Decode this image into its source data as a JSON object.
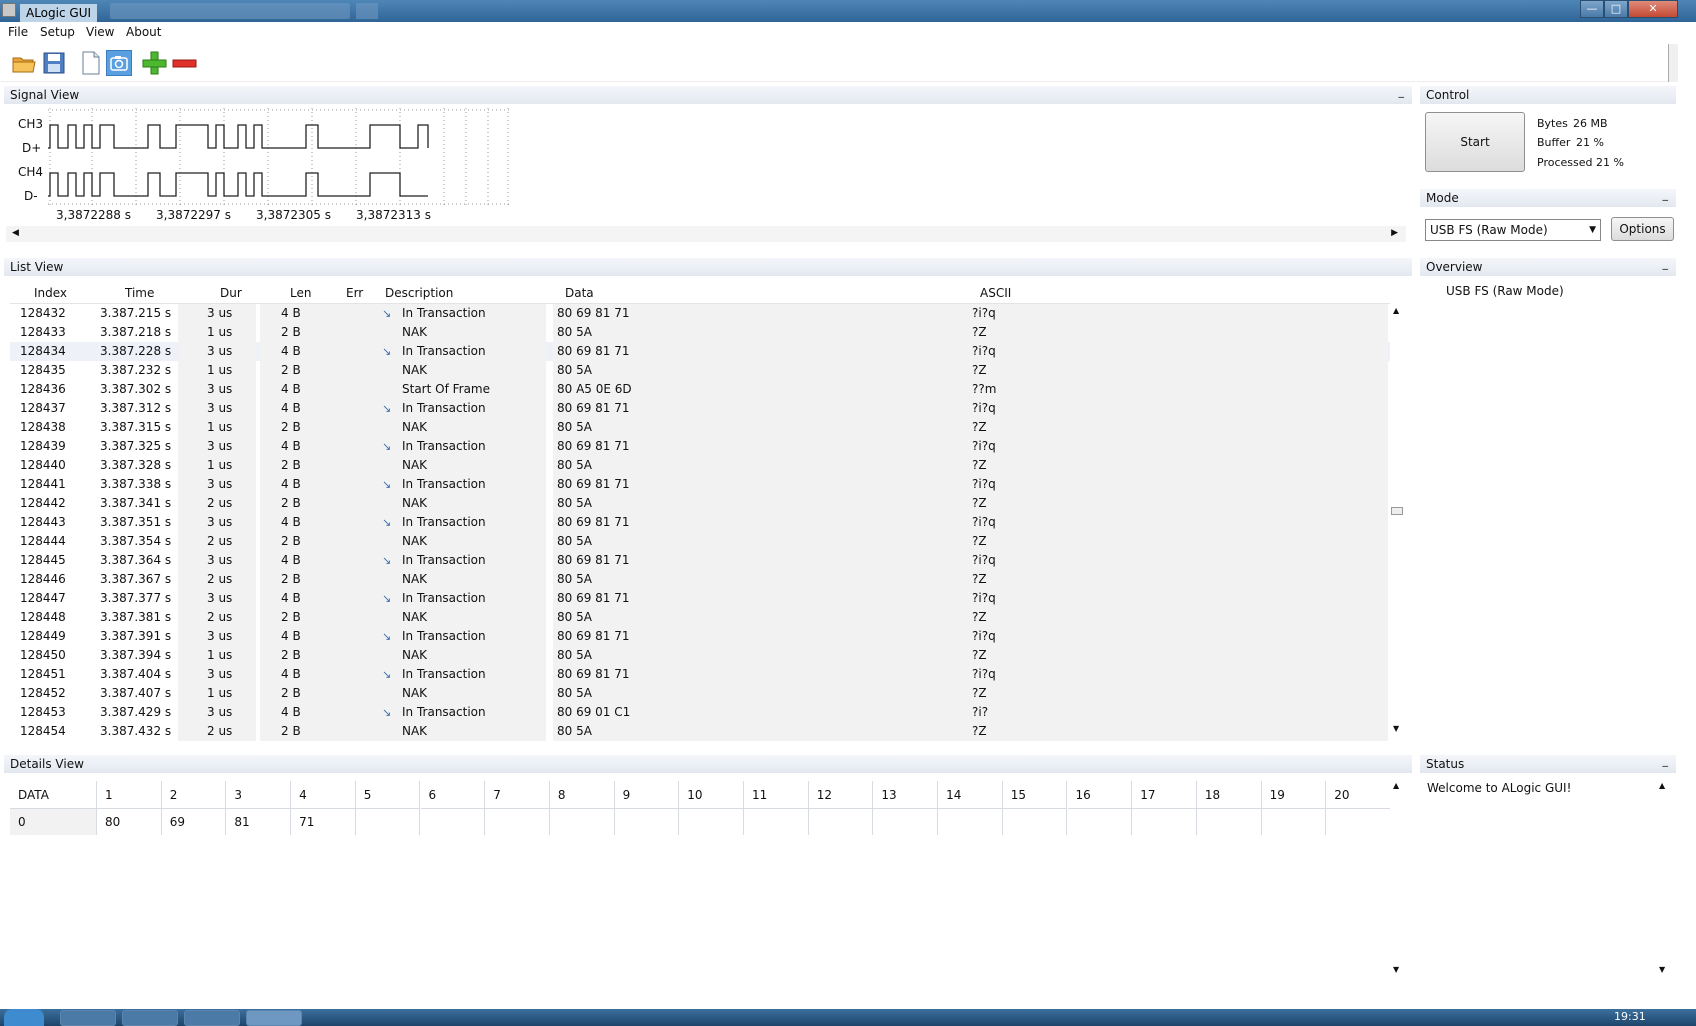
{
  "window": {
    "title": "ALogic GUI"
  },
  "menu": [
    "File",
    "Setup",
    "View",
    "About"
  ],
  "panels": {
    "signal_view": "Signal View",
    "list_view": "List View",
    "details_view": "Details View",
    "control": "Control",
    "mode": "Mode",
    "overview": "Overview",
    "status": "Status",
    "minimize": "_"
  },
  "signal": {
    "channels": [
      "CH3",
      "D+",
      "CH4",
      "D-"
    ],
    "time_labels": [
      "3,3872288 s",
      "3,3872297 s",
      "3,3872305 s",
      "3,3872313 s"
    ]
  },
  "list": {
    "columns": [
      "Index",
      "Time",
      "Dur",
      "Len",
      "Err",
      "Description",
      "Data",
      "ASCII"
    ],
    "rows": [
      {
        "index": "128432",
        "time": "3.387.215 s",
        "dur": "3 us",
        "len": "4 B",
        "err": "",
        "desc": "In Transaction",
        "data": "80 69 81 71",
        "ascii": "?i?q",
        "icon": true
      },
      {
        "index": "128433",
        "time": "3.387.218 s",
        "dur": "1 us",
        "len": "2 B",
        "err": "",
        "desc": "NAK",
        "data": "80 5A",
        "ascii": "?Z",
        "icon": false
      },
      {
        "index": "128434",
        "time": "3.387.228 s",
        "dur": "3 us",
        "len": "4 B",
        "err": "",
        "desc": "In Transaction",
        "data": "80 69 81 71",
        "ascii": "?i?q",
        "icon": true
      },
      {
        "index": "128435",
        "time": "3.387.232 s",
        "dur": "1 us",
        "len": "2 B",
        "err": "",
        "desc": "NAK",
        "data": "80 5A",
        "ascii": "?Z",
        "icon": false
      },
      {
        "index": "128436",
        "time": "3.387.302 s",
        "dur": "3 us",
        "len": "4 B",
        "err": "",
        "desc": "Start Of Frame",
        "data": "80 A5 0E 6D",
        "ascii": "??m",
        "icon": false
      },
      {
        "index": "128437",
        "time": "3.387.312 s",
        "dur": "3 us",
        "len": "4 B",
        "err": "",
        "desc": "In Transaction",
        "data": "80 69 81 71",
        "ascii": "?i?q",
        "icon": true
      },
      {
        "index": "128438",
        "time": "3.387.315 s",
        "dur": "1 us",
        "len": "2 B",
        "err": "",
        "desc": "NAK",
        "data": "80 5A",
        "ascii": "?Z",
        "icon": false
      },
      {
        "index": "128439",
        "time": "3.387.325 s",
        "dur": "3 us",
        "len": "4 B",
        "err": "",
        "desc": "In Transaction",
        "data": "80 69 81 71",
        "ascii": "?i?q",
        "icon": true
      },
      {
        "index": "128440",
        "time": "3.387.328 s",
        "dur": "1 us",
        "len": "2 B",
        "err": "",
        "desc": "NAK",
        "data": "80 5A",
        "ascii": "?Z",
        "icon": false
      },
      {
        "index": "128441",
        "time": "3.387.338 s",
        "dur": "3 us",
        "len": "4 B",
        "err": "",
        "desc": "In Transaction",
        "data": "80 69 81 71",
        "ascii": "?i?q",
        "icon": true
      },
      {
        "index": "128442",
        "time": "3.387.341 s",
        "dur": "2 us",
        "len": "2 B",
        "err": "",
        "desc": "NAK",
        "data": "80 5A",
        "ascii": "?Z",
        "icon": false
      },
      {
        "index": "128443",
        "time": "3.387.351 s",
        "dur": "3 us",
        "len": "4 B",
        "err": "",
        "desc": "In Transaction",
        "data": "80 69 81 71",
        "ascii": "?i?q",
        "icon": true
      },
      {
        "index": "128444",
        "time": "3.387.354 s",
        "dur": "2 us",
        "len": "2 B",
        "err": "",
        "desc": "NAK",
        "data": "80 5A",
        "ascii": "?Z",
        "icon": false
      },
      {
        "index": "128445",
        "time": "3.387.364 s",
        "dur": "3 us",
        "len": "4 B",
        "err": "",
        "desc": "In Transaction",
        "data": "80 69 81 71",
        "ascii": "?i?q",
        "icon": true
      },
      {
        "index": "128446",
        "time": "3.387.367 s",
        "dur": "2 us",
        "len": "2 B",
        "err": "",
        "desc": "NAK",
        "data": "80 5A",
        "ascii": "?Z",
        "icon": false
      },
      {
        "index": "128447",
        "time": "3.387.377 s",
        "dur": "3 us",
        "len": "4 B",
        "err": "",
        "desc": "In Transaction",
        "data": "80 69 81 71",
        "ascii": "?i?q",
        "icon": true
      },
      {
        "index": "128448",
        "time": "3.387.381 s",
        "dur": "2 us",
        "len": "2 B",
        "err": "",
        "desc": "NAK",
        "data": "80 5A",
        "ascii": "?Z",
        "icon": false
      },
      {
        "index": "128449",
        "time": "3.387.391 s",
        "dur": "3 us",
        "len": "4 B",
        "err": "",
        "desc": "In Transaction",
        "data": "80 69 81 71",
        "ascii": "?i?q",
        "icon": true
      },
      {
        "index": "128450",
        "time": "3.387.394 s",
        "dur": "1 us",
        "len": "2 B",
        "err": "",
        "desc": "NAK",
        "data": "80 5A",
        "ascii": "?Z",
        "icon": false
      },
      {
        "index": "128451",
        "time": "3.387.404 s",
        "dur": "3 us",
        "len": "4 B",
        "err": "",
        "desc": "In Transaction",
        "data": "80 69 81 71",
        "ascii": "?i?q",
        "icon": true
      },
      {
        "index": "128452",
        "time": "3.387.407 s",
        "dur": "1 us",
        "len": "2 B",
        "err": "",
        "desc": "NAK",
        "data": "80 5A",
        "ascii": "?Z",
        "icon": false
      },
      {
        "index": "128453",
        "time": "3.387.429 s",
        "dur": "3 us",
        "len": "4 B",
        "err": "",
        "desc": "In Transaction",
        "data": "80 69 01 C1",
        "ascii": "?i?",
        "icon": true
      },
      {
        "index": "128454",
        "time": "3.387.432 s",
        "dur": "2 us",
        "len": "2 B",
        "err": "",
        "desc": "NAK",
        "data": "80 5A",
        "ascii": "?Z",
        "icon": false
      }
    ]
  },
  "details": {
    "columns": [
      "DATA",
      "1",
      "2",
      "3",
      "4",
      "5",
      "6",
      "7",
      "8",
      "9",
      "10",
      "11",
      "12",
      "13",
      "14",
      "15",
      "16",
      "17",
      "18",
      "19",
      "20"
    ],
    "row": [
      "0",
      "80",
      "69",
      "81",
      "71",
      "",
      "",
      "",
      "",
      "",
      "",
      "",
      "",
      "",
      "",
      "",
      "",
      "",
      "",
      "",
      ""
    ]
  },
  "control": {
    "start_label": "Start",
    "stats": [
      {
        "label": "Bytes",
        "value": "26 MB"
      },
      {
        "label": "Buffer",
        "value": "21 %"
      },
      {
        "label": "Processed",
        "value": "21 %"
      }
    ]
  },
  "mode": {
    "selected": "USB FS (Raw Mode)",
    "options_label": "Options"
  },
  "overview": {
    "text": "USB FS (Raw Mode)"
  },
  "status": {
    "text": "Welcome to ALogic GUI!"
  },
  "taskbar": {
    "clock": "19:31"
  },
  "colors": {
    "titlebar": "#2f6496",
    "panel_header": "#e3e8f0",
    "selected_row": "#eef2f8",
    "accent": "#5aa0e0"
  }
}
